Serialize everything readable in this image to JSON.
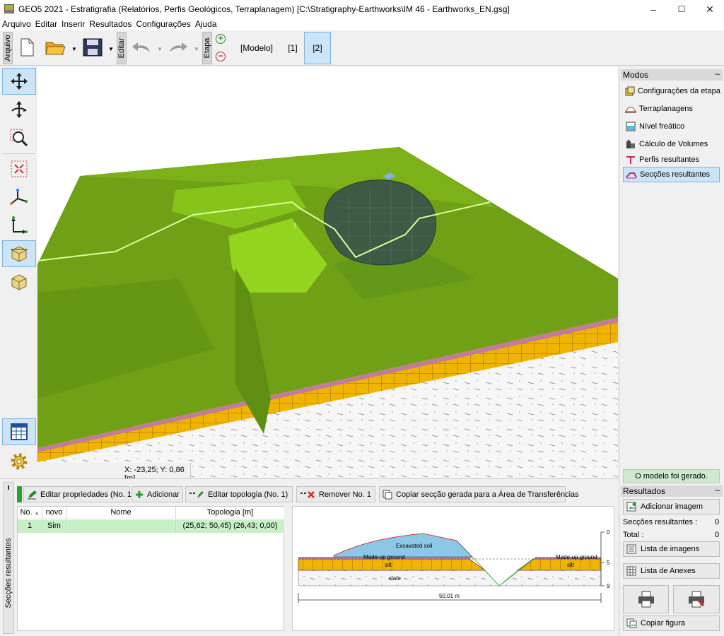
{
  "window": {
    "title": "GEO5 2021 - Estratigrafia (Relatórios, Perfis Geológicos, Terraplanagem) [C:\\Stratigraphy-Earthworks\\IM 46 - Earthworks_EN.gsg]",
    "minimize": "–",
    "maximize": "☐",
    "close": "✕"
  },
  "menu": [
    "Arquivo",
    "Editar",
    "Inserir",
    "Resultados",
    "Configurações",
    "Ajuda"
  ],
  "toolbar": {
    "arquivo_tab": "Arquivo",
    "editar_tab": "Editar",
    "etapa_tab": "Etapa",
    "stages": [
      "[Modelo]",
      "[1]",
      "[2]"
    ],
    "active_stage": "[2]"
  },
  "viewport": {
    "label_point": "1",
    "coords": "X: -23,25; Y: 0,86 [m]"
  },
  "modes": {
    "header": "Modos",
    "collapse": "–",
    "items": [
      {
        "label": "Configurações da etapa",
        "active": false
      },
      {
        "label": "Terraplanagens",
        "active": false
      },
      {
        "label": "Nível freático",
        "active": false
      },
      {
        "label": "Cálculo de Volumes",
        "active": false
      },
      {
        "label": "Perfis resultantes",
        "active": false
      },
      {
        "label": "Secções resultantes",
        "active": true
      }
    ]
  },
  "status": "O modelo foi gerado.",
  "results": {
    "header": "Resultados",
    "collapse": "–",
    "add_image": "Adicionar imagem",
    "sections_label": "Secções resultantes :",
    "sections_value": "0",
    "total_label": "Total :",
    "total_value": "0",
    "image_list": "Lista de imagens",
    "annex_list": "Lista de Anexes",
    "copy_figure": "Copiar figura"
  },
  "bottom": {
    "side_tab": "Secções resultantes",
    "buttons": {
      "edit_props": "Editar propriedades (No. 1)",
      "add": "Adicionar",
      "edit_topology": "Editar topologia (No. 1)",
      "remove": "Remover No. 1",
      "copy_section": "Copiar secção gerada para a Área de Transferências"
    },
    "table": {
      "headers": [
        "No.",
        "novo",
        "Nome",
        "Topologia [m]"
      ],
      "rows": [
        {
          "no": "1",
          "novo": "Sim",
          "nome": "",
          "topologia": "(25,62; 50,45) (26,43; 0,00)"
        }
      ]
    },
    "section_preview": {
      "layers": [
        "Excavated soil",
        "Made-up ground",
        "silt",
        "slate"
      ],
      "depth_ticks": [
        "0",
        "5",
        "9"
      ],
      "width_label": "50,01 m"
    }
  },
  "colors": {
    "terrain": "#6fa016",
    "terrain_light": "#8fcf1a",
    "silt": "#f0b400",
    "madeup": "#c47a9a",
    "selection": "#cce4f7",
    "status_bg": "#cfe8cf"
  }
}
